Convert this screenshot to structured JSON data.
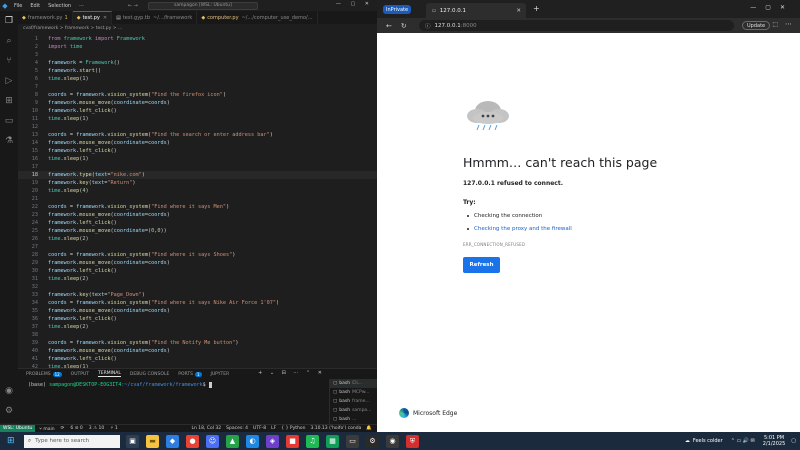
{
  "vscode": {
    "menu": [
      "File",
      "Edit",
      "Selection",
      "···"
    ],
    "search_text": "sampagon [WSL: Ubuntu]",
    "tabs": [
      {
        "name": "framework.py",
        "mod": "1",
        "active": false
      },
      {
        "name": "test.py",
        "mod": "",
        "active": true
      },
      {
        "name": "test.gyp.tb",
        "mod": "",
        "extra": "~/.../framework",
        "active": false
      },
      {
        "name": "computer.py",
        "mod": "",
        "extra": "~/.../computer_use_demo/...",
        "active": false
      }
    ],
    "breadcrumb": "cvaf/framework > framework > test.py > ...",
    "code_lines": [
      {
        "ln": "1",
        "html": "<span class=\"k\">from</span> <span class=\"c\">framework</span> <span class=\"k\">import</span> <span class=\"c\">Framework</span>"
      },
      {
        "ln": "2",
        "html": "<span class=\"k\">import</span> <span class=\"c\">time</span>"
      },
      {
        "ln": "3",
        "html": ""
      },
      {
        "ln": "4",
        "html": "<span class=\"v\">framework</span> = <span class=\"c\">Framework</span>()"
      },
      {
        "ln": "5",
        "html": "<span class=\"v\">framework</span>.<span class=\"f\">start</span>()"
      },
      {
        "ln": "6",
        "html": "<span class=\"c\">time</span>.<span class=\"f\">sleep</span>(<span class=\"n\">1</span>)"
      },
      {
        "ln": "7",
        "html": ""
      },
      {
        "ln": "8",
        "html": "<span class=\"v\">coords</span> = <span class=\"v\">framework</span>.<span class=\"f\">vision_system</span>(<span class=\"s\">\"Find the firefox icon\"</span>)"
      },
      {
        "ln": "9",
        "html": "<span class=\"v\">framework</span>.<span class=\"f\">mouse_move</span>(<span class=\"v\">coordinate</span>=<span class=\"v\">coords</span>)"
      },
      {
        "ln": "10",
        "html": "<span class=\"v\">framework</span>.<span class=\"f\">left_click</span>()"
      },
      {
        "ln": "11",
        "html": "<span class=\"c\">time</span>.<span class=\"f\">sleep</span>(<span class=\"n\">1</span>)"
      },
      {
        "ln": "12",
        "html": ""
      },
      {
        "ln": "13",
        "html": "<span class=\"v\">coords</span> = <span class=\"v\">framework</span>.<span class=\"f\">vision_system</span>(<span class=\"s\">\"Find the search or enter address bar\"</span>)"
      },
      {
        "ln": "14",
        "html": "<span class=\"v\">framework</span>.<span class=\"f\">mouse_move</span>(<span class=\"v\">coordinate</span>=<span class=\"v\">coords</span>)"
      },
      {
        "ln": "15",
        "html": "<span class=\"v\">framework</span>.<span class=\"f\">left_click</span>()"
      },
      {
        "ln": "16",
        "html": "<span class=\"c\">time</span>.<span class=\"f\">sleep</span>(<span class=\"n\">1</span>)"
      },
      {
        "ln": "17",
        "html": ""
      },
      {
        "ln": "18",
        "html": "<span class=\"v\">framework</span>.<span class=\"f\">type</span>(<span class=\"v\">text</span>=<span class=\"s\">\"nike.com\"</span>)",
        "current": true
      },
      {
        "ln": "19",
        "html": "<span class=\"v\">framework</span>.<span class=\"f\">key</span>(<span class=\"v\">text</span>=<span class=\"s\">\"Return\"</span>)"
      },
      {
        "ln": "20",
        "html": "<span class=\"c\">time</span>.<span class=\"f\">sleep</span>(<span class=\"n\">4</span>)"
      },
      {
        "ln": "21",
        "html": ""
      },
      {
        "ln": "22",
        "html": "<span class=\"v\">coords</span> = <span class=\"v\">framework</span>.<span class=\"f\">vision_system</span>(<span class=\"s\">\"Find where it says Men\"</span>)"
      },
      {
        "ln": "23",
        "html": "<span class=\"v\">framework</span>.<span class=\"f\">mouse_move</span>(<span class=\"v\">coordinate</span>=<span class=\"v\">coords</span>)"
      },
      {
        "ln": "24",
        "html": "<span class=\"v\">framework</span>.<span class=\"f\">left_click</span>()"
      },
      {
        "ln": "25",
        "html": "<span class=\"v\">framework</span>.<span class=\"f\">mouse_move</span>(<span class=\"v\">coordinate</span>=(<span class=\"n\">0</span>,<span class=\"n\">0</span>))"
      },
      {
        "ln": "26",
        "html": "<span class=\"c\">time</span>.<span class=\"f\">sleep</span>(<span class=\"n\">2</span>)"
      },
      {
        "ln": "27",
        "html": ""
      },
      {
        "ln": "28",
        "html": "<span class=\"v\">coords</span> = <span class=\"v\">framework</span>.<span class=\"f\">vision_system</span>(<span class=\"s\">\"Find where it says Shoes\"</span>)"
      },
      {
        "ln": "29",
        "html": "<span class=\"v\">framework</span>.<span class=\"f\">mouse_move</span>(<span class=\"v\">coordinate</span>=<span class=\"v\">coords</span>)"
      },
      {
        "ln": "30",
        "html": "<span class=\"v\">framework</span>.<span class=\"f\">left_click</span>()"
      },
      {
        "ln": "31",
        "html": "<span class=\"c\">time</span>.<span class=\"f\">sleep</span>(<span class=\"n\">2</span>)"
      },
      {
        "ln": "32",
        "html": ""
      },
      {
        "ln": "33",
        "html": "<span class=\"v\">framework</span>.<span class=\"f\">key</span>(<span class=\"v\">text</span>=<span class=\"s\">\"Page_Down\"</span>)"
      },
      {
        "ln": "34",
        "html": "<span class=\"v\">coords</span> = <span class=\"v\">framework</span>.<span class=\"f\">vision_system</span>(<span class=\"s\">\"Find where it says Nike Air Force 1'07\"</span>)"
      },
      {
        "ln": "35",
        "html": "<span class=\"v\">framework</span>.<span class=\"f\">mouse_move</span>(<span class=\"v\">coordinate</span>=<span class=\"v\">coords</span>)"
      },
      {
        "ln": "36",
        "html": "<span class=\"v\">framework</span>.<span class=\"f\">left_click</span>()"
      },
      {
        "ln": "37",
        "html": "<span class=\"c\">time</span>.<span class=\"f\">sleep</span>(<span class=\"n\">2</span>)"
      },
      {
        "ln": "38",
        "html": ""
      },
      {
        "ln": "39",
        "html": "<span class=\"v\">coords</span> = <span class=\"v\">framework</span>.<span class=\"f\">vision_system</span>(<span class=\"s\">\"Find the Notify Me button\"</span>)"
      },
      {
        "ln": "40",
        "html": "<span class=\"v\">framework</span>.<span class=\"f\">mouse_move</span>(<span class=\"v\">coordinate</span>=<span class=\"v\">coords</span>)"
      },
      {
        "ln": "41",
        "html": "<span class=\"v\">framework</span>.<span class=\"f\">left_click</span>()"
      },
      {
        "ln": "42",
        "html": "<span class=\"c\">time</span>.<span class=\"f\">sleep</span>(<span class=\"n\">1</span>)"
      }
    ],
    "panel_tabs": [
      {
        "label": "PROBLEMS",
        "badge": "12"
      },
      {
        "label": "OUTPUT",
        "badge": ""
      },
      {
        "label": "TERMINAL",
        "badge": "",
        "active": true
      },
      {
        "label": "DEBUG CONSOLE",
        "badge": ""
      },
      {
        "label": "PORTS",
        "badge": "1"
      },
      {
        "label": "JUPYTER",
        "badge": ""
      }
    ],
    "terminal": {
      "env": "(base) ",
      "user": "sampagon@DESKTOP-EOG3IT4",
      "path": ":~/cvaf/framework/framework",
      "prompt": "$ "
    },
    "terminal_list": [
      {
        "name": "bash",
        "meta": "Cli...",
        "selected": true
      },
      {
        "name": "bash",
        "meta": "MCPw...",
        "selected": false
      },
      {
        "name": "bash",
        "meta": "frame...",
        "selected": false
      },
      {
        "name": "bash",
        "meta": "sampa...",
        "selected": false
      },
      {
        "name": "bash",
        "meta": "...",
        "selected": false
      }
    ],
    "status": {
      "remote": "WSL: Ubuntu",
      "branch": "main",
      "sync": "⟳",
      "errors": "6 ⊘ 0",
      "warnings": "3 ⚠ 10",
      "ports": "1",
      "position": "Ln 18, Col 32",
      "spaces": "Spaces: 4",
      "encoding": "UTF-8",
      "eol": "LF",
      "language": "{ } Python",
      "interpreter": "3.10.13 ('hoifo') conda"
    }
  },
  "edge": {
    "inprivate": "InPrivate",
    "tab_title": "127.0.0.1",
    "url_host": "127.0.0.1",
    "url_port": ":8000",
    "update_label": "Update",
    "error": {
      "title": "Hmmm… can't reach this page",
      "subtitle": "127.0.0.1 refused to connect.",
      "try_label": "Try:",
      "suggestions": [
        "Checking the connection",
        "Checking the proxy and the firewall"
      ],
      "code": "ERR_CONNECTION_REFUSED",
      "refresh_label": "Refresh"
    },
    "brand": "Microsoft Edge"
  },
  "taskbar": {
    "search_placeholder": "Type here to search",
    "weather": "Feels colder",
    "time": "5:01 PM",
    "date": "2/1/2025"
  }
}
